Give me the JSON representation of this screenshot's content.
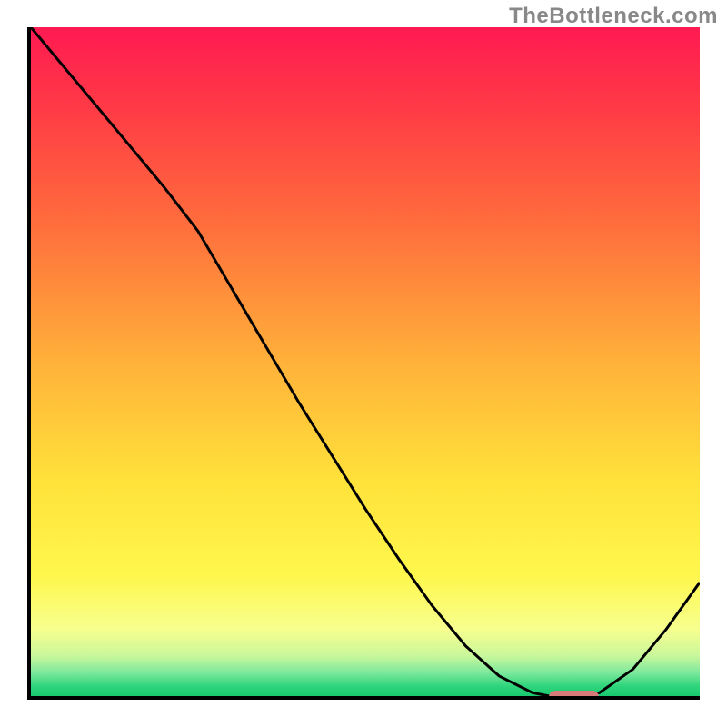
{
  "watermark_text": "TheBottleneck.com",
  "chart_data": {
    "type": "line",
    "title": "",
    "xlabel": "",
    "ylabel": "",
    "x": [
      0.0,
      0.05,
      0.1,
      0.15,
      0.2,
      0.25,
      0.3,
      0.35,
      0.4,
      0.45,
      0.5,
      0.55,
      0.6,
      0.65,
      0.7,
      0.75,
      0.775,
      0.8,
      0.82,
      0.85,
      0.9,
      0.95,
      1.0
    ],
    "y": [
      1.0,
      0.94,
      0.88,
      0.82,
      0.76,
      0.695,
      0.61,
      0.525,
      0.44,
      0.36,
      0.28,
      0.205,
      0.135,
      0.075,
      0.03,
      0.005,
      0.0,
      0.0,
      0.0,
      0.005,
      0.04,
      0.1,
      0.17
    ],
    "xlim": [
      0,
      1
    ],
    "ylim": [
      0,
      1
    ],
    "gradient_stops": [
      {
        "offset": 0.0,
        "color": "#ff1a52"
      },
      {
        "offset": 0.12,
        "color": "#ff3a46"
      },
      {
        "offset": 0.3,
        "color": "#ff6f3c"
      },
      {
        "offset": 0.5,
        "color": "#ffb13a"
      },
      {
        "offset": 0.68,
        "color": "#ffe23a"
      },
      {
        "offset": 0.82,
        "color": "#fff74d"
      },
      {
        "offset": 0.9,
        "color": "#f7ff8e"
      },
      {
        "offset": 0.94,
        "color": "#c9f79b"
      },
      {
        "offset": 0.965,
        "color": "#7de89c"
      },
      {
        "offset": 0.985,
        "color": "#2fd57c"
      },
      {
        "offset": 1.0,
        "color": "#18c96f"
      }
    ],
    "marker": {
      "x_start": 0.77,
      "x_end": 0.845,
      "y": 0.0,
      "color": "#d77a7a"
    },
    "curve_color": "#000000",
    "curve_width": 3
  }
}
